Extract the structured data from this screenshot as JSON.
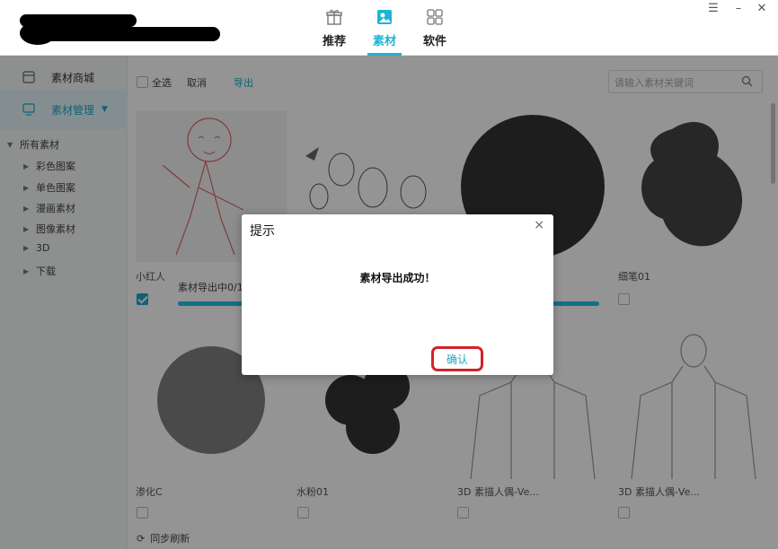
{
  "header": {
    "tabs": [
      {
        "label": "推荐",
        "icon": "gift-icon"
      },
      {
        "label": "素材",
        "icon": "material-icon",
        "active": true
      },
      {
        "label": "软件",
        "icon": "grid-icon"
      }
    ],
    "window_controls": [
      "☰",
      "–",
      "✕"
    ]
  },
  "sidebar": {
    "items": [
      {
        "label": "素材商城",
        "icon": "store-icon"
      },
      {
        "label": "素材管理",
        "icon": "monitor-icon",
        "active": true
      }
    ],
    "tree_root": "所有素材",
    "tree_children": [
      "彩色图案",
      "单色图案",
      "漫画素材",
      "图像素材",
      "3D",
      "下载"
    ]
  },
  "toolbar": {
    "select_all": "全选",
    "cancel": "取消",
    "export": "导出",
    "search_placeholder": "请输入素材关键词"
  },
  "grid": {
    "items": [
      {
        "name": "小红人",
        "checked": true
      },
      {
        "name": "",
        "checked": false
      },
      {
        "name": "",
        "checked": false
      },
      {
        "name": "细笔01",
        "checked": false
      },
      {
        "name": "渗化C",
        "checked": false
      },
      {
        "name": "水粉01",
        "checked": false
      },
      {
        "name": "3D 素描人偶-Ve...",
        "checked": false
      },
      {
        "name": "3D 素描人偶-Ve...",
        "checked": false
      }
    ],
    "sync": "同步刷新"
  },
  "progress": {
    "text": "素材导出中0/1",
    "fraction": 0.0
  },
  "dialog": {
    "title": "提示",
    "close": "×",
    "message": "素材导出成功！",
    "confirm": "确认"
  },
  "colors": {
    "accent": "#1fb3d4",
    "progress": "#22c1e6",
    "highlight_ring": "#d2232a"
  }
}
